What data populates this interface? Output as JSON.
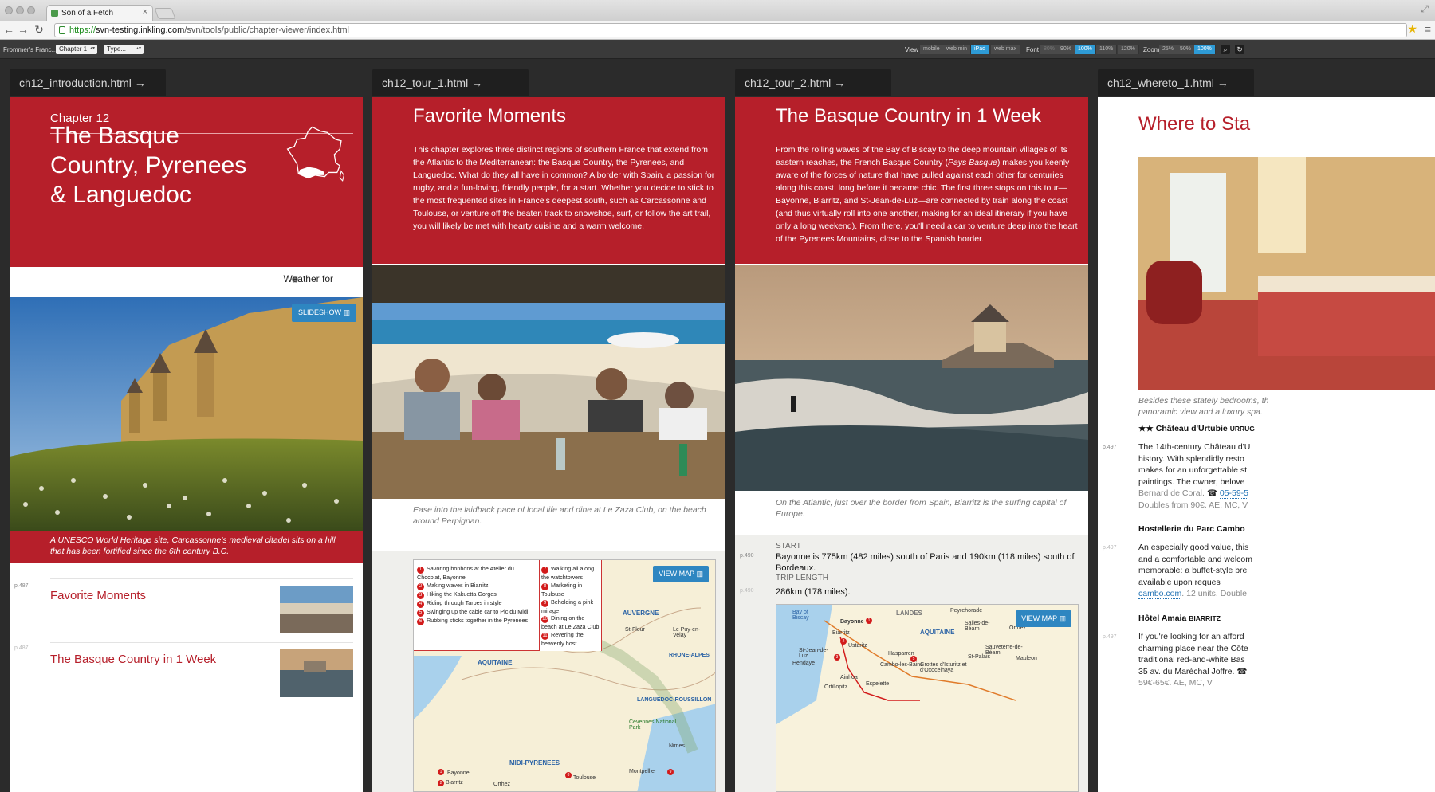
{
  "browser": {
    "tab_title": "Son of a Fetch",
    "url_scheme": "https://",
    "url_host": "svn-testing.inkling.com",
    "url_path": "/svn/tools/public/chapter-viewer/index.html"
  },
  "app_toolbar": {
    "title": "Frommer's Franc...",
    "chapter_select": "Chapter 1",
    "type_select": "Type...",
    "view_label": "View",
    "view_options": [
      "mobile",
      "web min",
      "iPad",
      "web max"
    ],
    "view_selected": "iPad",
    "font_label": "Font",
    "font_options": [
      "80%",
      "90%",
      "100%",
      "110%",
      "120%"
    ],
    "font_selected": "100%",
    "zoom_label": "Zoom",
    "zoom_options": [
      "25%",
      "50%",
      "100%"
    ],
    "zoom_selected": "100%"
  },
  "panes": [
    {
      "tab": "ch12_introduction.html →",
      "chapter_label": "Chapter 12",
      "title": "The Basque Country, Pyrenees & Languedoc",
      "weather": "Weather for",
      "slideshow": "SLIDESHOW",
      "caption": "A UNESCO World Heritage site, Carcassonne's medieval citadel sits on a hill that has been fortified since the 6th century B.C.",
      "links": [
        {
          "page": "p.487",
          "title": "Favorite Moments"
        },
        {
          "page": "p.487",
          "title": "The Basque Country in 1 Week"
        }
      ]
    },
    {
      "tab": "ch12_tour_1.html →",
      "title": "Favorite Moments",
      "body": "This chapter explores three distinct regions of southern France that extend from the Atlantic to the Mediterranean: the Basque Country, the Pyrenees, and Languedoc. What do they all have in common? A border with Spain, a passion for rugby, and a fun-loving, friendly people, for a start. Whether you decide to stick to the most frequented sites in France's deepest south, such as Carcassonne and Toulouse, or venture off the beaten track to snowshoe, surf, or follow the art trail, you will likely be met with hearty cuisine and a warm welcome.",
      "caption": "Ease into the laidback pace of local life and dine at Le Zaza Club, on the beach around Perpignan.",
      "view_map": "VIEW MAP",
      "legend_left": [
        "Savoring bonbons at the Atelier du Chocolat, Bayonne",
        "Making waves in Biarritz",
        "Hiking the Kakuetta Gorges",
        "Riding through Tarbes in style",
        "Swinging up the cable car to Pic du Midi",
        "Rubbing sticks together in the Pyrenees"
      ],
      "legend_right": [
        "Walking all along the watchtowers",
        "Marketing in Toulouse",
        "Beholding a pink mirage",
        "Dining on the beach at Le Zaza Club",
        "Revering the heavenly host"
      ],
      "map_places": [
        "AUVERGNE",
        "AQUITAINE",
        "MIDI-PYRENEES",
        "LANGUEDOC-ROUSSILLON",
        "RHONE-ALPES",
        "Toulouse",
        "Montpellier",
        "Nimes",
        "Bayonne",
        "Biarritz",
        "Orthez",
        "St-Flour",
        "Le Puy-en-Velay",
        "Cevennes National Park"
      ]
    },
    {
      "tab": "ch12_tour_2.html →",
      "title": "The Basque Country in 1 Week",
      "body_before_italic": "From the rolling waves of the Bay of Biscay to the deep mountain villages of its eastern reaches, the French Basque Country (",
      "body_italic": "Pays Basque",
      "body_after_italic": ") makes you keenly aware of the forces of nature that have pulled against each other for centuries along this coast, long before it became chic. The first three stops on this tour—Bayonne, Biarritz, and St-Jean-de-Luz—are connected by train along the coast (and thus virtually roll into one another, making for an ideal itinerary if you have only a long weekend). From there, you'll need a car to venture deep into the heart of the Pyrenees Mountains, close to the Spanish border.",
      "caption": "On the Atlantic, just over the border from Spain, Biarritz is the surfing capital of Europe.",
      "start_label": "START",
      "start_page": "p.490",
      "start_value": "Bayonne is 775km (482 miles) south of Paris and 190km (118 miles) south of Bordeaux.",
      "trip_label": "TRIP LENGTH",
      "trip_page": "p.490",
      "trip_value": "286km (178 miles).",
      "view_map": "VIEW MAP",
      "map_places": [
        "Bay of Biscay",
        "Bayonne",
        "Biarritz",
        "AQUITAINE",
        "LANDES",
        "Peyrehorade",
        "Orthez",
        "Salies-de-Béarn",
        "Sauveterre-de-Béarn",
        "Mauleon",
        "Ustaritz",
        "Hasparren",
        "Cambo-les-Bains",
        "St-Palais",
        "St-Jean-de-Luz",
        "Hendaye",
        "Ainhoa",
        "Ortillopitz",
        "Espelette",
        "Grottes d'Isturitz et d'Oxocelhaya"
      ]
    },
    {
      "tab": "ch12_whereto_1.html →",
      "title": "Where to Sta",
      "caption": [
        "Besides these stately bedrooms, th",
        "panoramic view and a luxury spa."
      ],
      "h1_stars": "★★",
      "h1_name": "Château d'Urtubie",
      "h1_loc": "URRUG",
      "h1_page": "p.497",
      "h1_lines": [
        "The 14th-century Château d'U",
        "history. With splendidly resto",
        "makes for an unforgettable st",
        "paintings. The owner, belove",
        "Bernard de Coral."
      ],
      "h1_phone": "05-59-5",
      "h1_price": "Doubles from 90€. AE, MC, V",
      "h2_name": "Hostellerie du Parc Cambo",
      "h2_page": "p.497",
      "h2_lines": [
        "An especially good value, this",
        "and a comfortable and welcom",
        "memorable: a buffet-style bre",
        "available upon reques"
      ],
      "h2_link": "cambo.com",
      "h2_price": ". 12 units. Double",
      "h3_name": "Hôtel Amaia",
      "h3_loc": "BIARRITZ",
      "h3_page": "p.497",
      "h3_lines": [
        "If you're looking for an afford",
        "charming place near the Côte",
        "traditional red-and-white Bas",
        "35 av. du Maréchal Joffre."
      ],
      "h3_price": "59€-65€. AE, MC, V"
    }
  ],
  "colors": {
    "brand_red": "#b61f2a",
    "accent_blue": "#2e86c1"
  }
}
